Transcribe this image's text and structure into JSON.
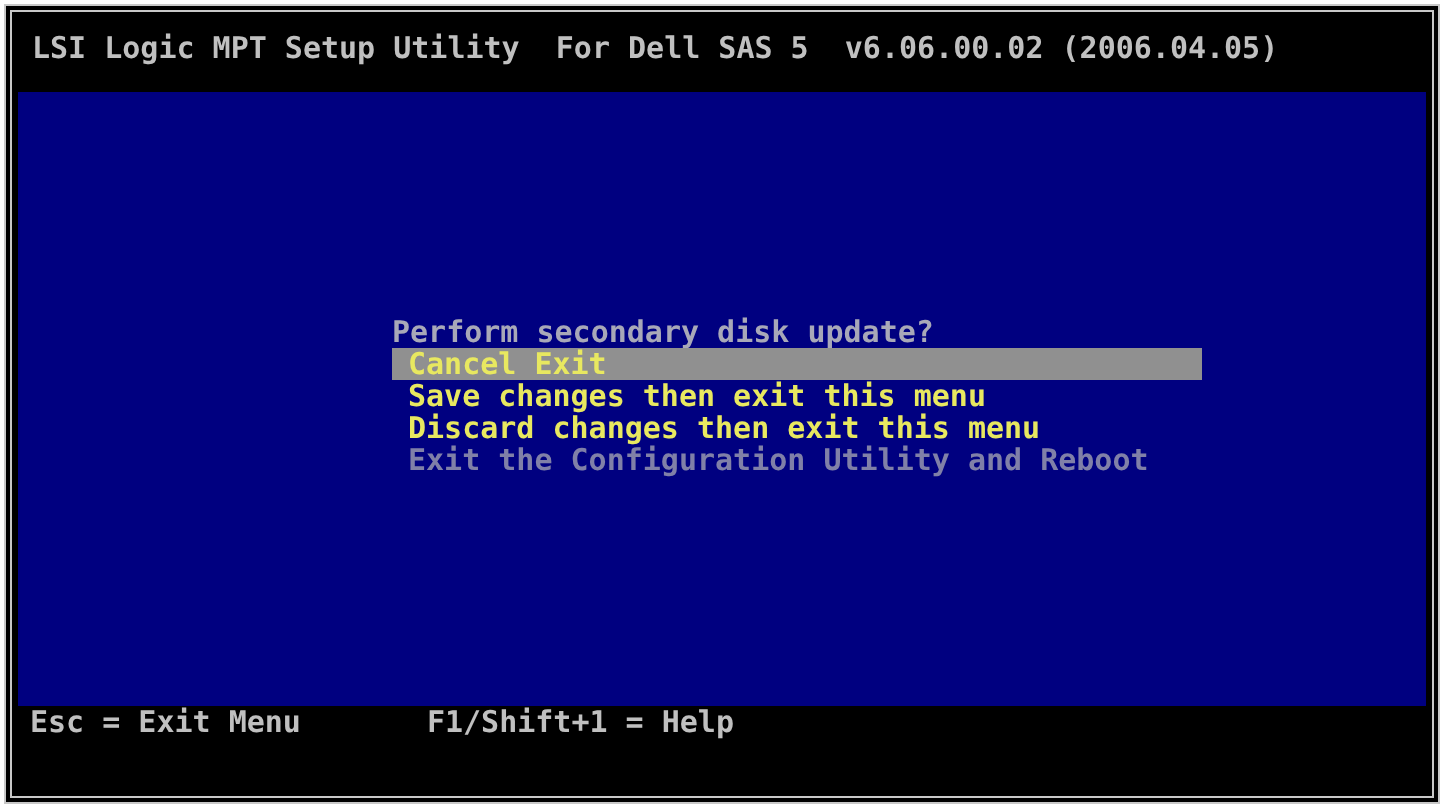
{
  "title_bar": {
    "title": "LSI Logic MPT Setup Utility  For Dell SAS 5  v6.06.00.02 (2006.04.05)"
  },
  "dialog": {
    "prompt": "Perform secondary disk update?",
    "options": [
      {
        "label": "Cancel Exit",
        "selected": true,
        "disabled": false
      },
      {
        "label": "Save changes then exit this menu",
        "selected": false,
        "disabled": false
      },
      {
        "label": "Discard changes then exit this menu",
        "selected": false,
        "disabled": false
      },
      {
        "label": "Exit the Configuration Utility and Reboot",
        "selected": false,
        "disabled": true
      }
    ]
  },
  "status_bar": {
    "hints": [
      "Esc = Exit Menu",
      "F1/Shift+1 = Help"
    ]
  }
}
